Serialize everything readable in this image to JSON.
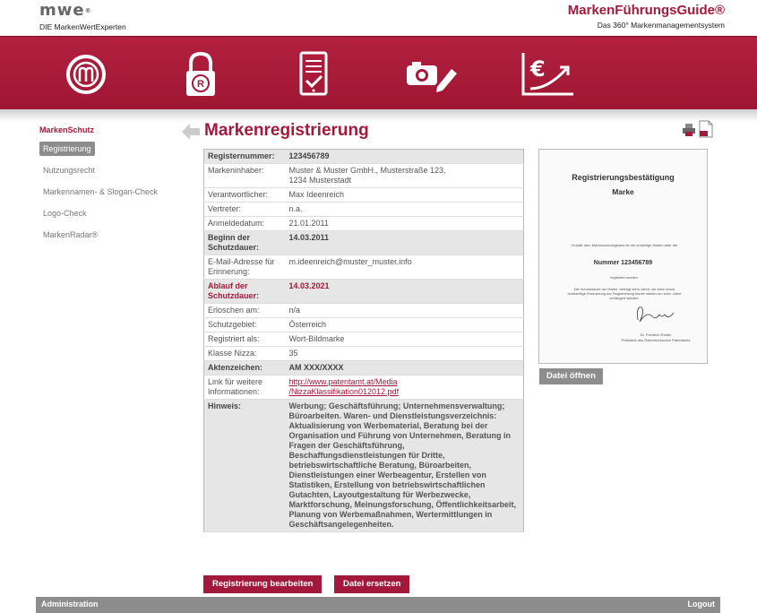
{
  "header": {
    "logo_mark": "mwe",
    "logo_reg": "®",
    "logo_sub": "DIE MarkenWertExperten",
    "brand_name": "MarkenFührungsGuide®",
    "brand_tag": "Das 360° Markenmanagementsystem"
  },
  "nav_icons": [
    "brand-m-icon",
    "padlock-registered-icon",
    "document-check-icon",
    "camera-pencil-icon",
    "euro-chart-icon"
  ],
  "sidebar": {
    "section": "MarkenSchutz",
    "items": [
      {
        "label": "Registrierung",
        "active": true
      },
      {
        "label": "Nutzungsrecht"
      },
      {
        "label": "Markennamen- & Slogan-Check"
      },
      {
        "label": "Logo-Check"
      },
      {
        "label": "MarkenRadar®"
      }
    ]
  },
  "title": "Markenregistrierung",
  "details": [
    {
      "k": "Registernummer:",
      "v": "123456789",
      "style": "shade"
    },
    {
      "k": "Markeninhaber:",
      "v": "Muster & Muster GmbH., Musterstraße 123,\n1234 Musterstadt"
    },
    {
      "k": "Verantwortlicher:",
      "v": "Max Ideenreich"
    },
    {
      "k": "Vertreter:",
      "v": "n.a."
    },
    {
      "k": "Anmeldedatum:",
      "v": "21.01.2011"
    },
    {
      "k": "Beginn der Schutzdauer:",
      "v": "14.03.2011",
      "style": "shade"
    },
    {
      "k": "E-Mail-Adresse für Erinnerung:",
      "v": "m.ideenreich@muster_muster.info"
    },
    {
      "k": "Ablauf der Schutzdauer:",
      "v": "14.03.2021",
      "style": "shade alert"
    },
    {
      "k": "Erloschen am:",
      "v": "n/a"
    },
    {
      "k": "Schutzgebiet:",
      "v": "Österreich"
    },
    {
      "k": "Registriert als:",
      "v": "Wort-Bildmarke"
    },
    {
      "k": "Klasse Nizza:",
      "v": "35"
    },
    {
      "k": "Aktenzeichen:",
      "v": "AM XXX/XXXX",
      "style": "shade"
    },
    {
      "k": "Link für weitere Informationen:",
      "v": "http://www.patentamt.at/Media\n/NizzaKlassifikation012012.pdf",
      "link": true
    },
    {
      "k": "Hinweis:",
      "v": "Werbung; Geschäftsführung; Unternehmensverwaltung; Büroarbeiten. Waren- und Dienstleistungsverzeichnis: Aktualisierung von Werbematerial, Beratung bei der Organisation und Führung von Unternehmen, Beratung in Fragen der Geschäftsführung, Beschaffungsdienstleistungen für Dritte, betriebswirtschaftliche Beratung, Büroarbeiten, Dienstleistungen einer Werbeagentur, Erstellen von Statistiken, Erstellung von betriebswirtschaftlichen Gutachten, Layoutgestaltung für Werbezwecke, Marktforschung, Meinungsforschung, Öffentlichkeitsarbeit, Planung von Werbemaßnahmen, Wertermittlungen in Geschäftsangelegenheiten.",
      "style": "shade hinweis"
    }
  ],
  "buttons": {
    "edit": "Registrierung bearbeiten",
    "replace": "Datei ersetzen",
    "open": "Datei öffnen"
  },
  "preview": {
    "title": "Registrierungsbestätigung",
    "subtitle": "Marke",
    "line1": "Gemäß dem Markenschutzgesetz ist die umseitige Marke unter der",
    "number": "Nummer  123456789",
    "line2": "registriert worden.",
    "line3": "Die Schutzdauer der Marke, beträgt zehn Jahre; sie kann durch rechtzeitige Erneuerung der Registrierung immer wieder um zehn Jahre verlängert werden.",
    "signer": "Dr. Friedrich Rödler",
    "signer_role": "Präsident des Österreichischen Patentamts"
  },
  "footer": {
    "left": "Administration",
    "right": "Logout"
  },
  "colors": {
    "brand_red": "#a3193b",
    "grey": "#8d8d8d"
  }
}
